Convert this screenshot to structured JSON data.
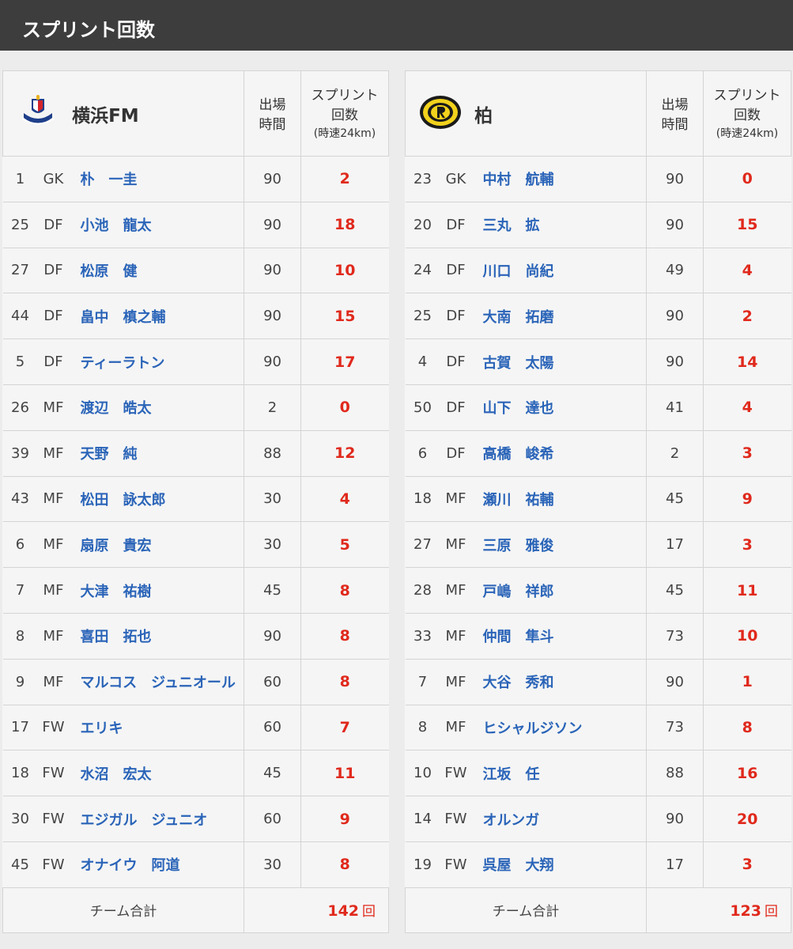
{
  "page_title": "スプリント回数",
  "columns": {
    "minutes": [
      "出場",
      "時間"
    ],
    "sprint": [
      "スプリント",
      "回数"
    ],
    "sprint_sub": "(時速24km)"
  },
  "total_label": "チーム合計",
  "total_unit": "回",
  "teams": [
    {
      "name": "横浜FM",
      "logo": "yokohama-fm-logo",
      "total": "142",
      "players": [
        {
          "no": "1",
          "pos": "GK",
          "name": "朴　一圭",
          "min": "90",
          "sprints": "2"
        },
        {
          "no": "25",
          "pos": "DF",
          "name": "小池　龍太",
          "min": "90",
          "sprints": "18"
        },
        {
          "no": "27",
          "pos": "DF",
          "name": "松原　健",
          "min": "90",
          "sprints": "10"
        },
        {
          "no": "44",
          "pos": "DF",
          "name": "畠中　槙之輔",
          "min": "90",
          "sprints": "15"
        },
        {
          "no": "5",
          "pos": "DF",
          "name": "ティーラトン",
          "min": "90",
          "sprints": "17"
        },
        {
          "no": "26",
          "pos": "MF",
          "name": "渡辺　皓太",
          "min": "2",
          "sprints": "0"
        },
        {
          "no": "39",
          "pos": "MF",
          "name": "天野　純",
          "min": "88",
          "sprints": "12"
        },
        {
          "no": "43",
          "pos": "MF",
          "name": "松田　詠太郎",
          "min": "30",
          "sprints": "4"
        },
        {
          "no": "6",
          "pos": "MF",
          "name": "扇原　貴宏",
          "min": "30",
          "sprints": "5"
        },
        {
          "no": "7",
          "pos": "MF",
          "name": "大津　祐樹",
          "min": "45",
          "sprints": "8"
        },
        {
          "no": "8",
          "pos": "MF",
          "name": "喜田　拓也",
          "min": "90",
          "sprints": "8"
        },
        {
          "no": "9",
          "pos": "MF",
          "name": "マルコス　ジュニオール",
          "min": "60",
          "sprints": "8"
        },
        {
          "no": "17",
          "pos": "FW",
          "name": "エリキ",
          "min": "60",
          "sprints": "7"
        },
        {
          "no": "18",
          "pos": "FW",
          "name": "水沼　宏太",
          "min": "45",
          "sprints": "11"
        },
        {
          "no": "30",
          "pos": "FW",
          "name": "エジガル　ジュニオ",
          "min": "60",
          "sprints": "9"
        },
        {
          "no": "45",
          "pos": "FW",
          "name": "オナイウ　阿道",
          "min": "30",
          "sprints": "8"
        }
      ]
    },
    {
      "name": "柏",
      "logo": "kashiwa-reysol-logo",
      "total": "123",
      "players": [
        {
          "no": "23",
          "pos": "GK",
          "name": "中村　航輔",
          "min": "90",
          "sprints": "0"
        },
        {
          "no": "20",
          "pos": "DF",
          "name": "三丸　拡",
          "min": "90",
          "sprints": "15"
        },
        {
          "no": "24",
          "pos": "DF",
          "name": "川口　尚紀",
          "min": "49",
          "sprints": "4"
        },
        {
          "no": "25",
          "pos": "DF",
          "name": "大南　拓磨",
          "min": "90",
          "sprints": "2"
        },
        {
          "no": "4",
          "pos": "DF",
          "name": "古賀　太陽",
          "min": "90",
          "sprints": "14"
        },
        {
          "no": "50",
          "pos": "DF",
          "name": "山下　達也",
          "min": "41",
          "sprints": "4"
        },
        {
          "no": "6",
          "pos": "DF",
          "name": "高橋　峻希",
          "min": "2",
          "sprints": "3"
        },
        {
          "no": "18",
          "pos": "MF",
          "name": "瀬川　祐輔",
          "min": "45",
          "sprints": "9"
        },
        {
          "no": "27",
          "pos": "MF",
          "name": "三原　雅俊",
          "min": "17",
          "sprints": "3"
        },
        {
          "no": "28",
          "pos": "MF",
          "name": "戸嶋　祥郎",
          "min": "45",
          "sprints": "11"
        },
        {
          "no": "33",
          "pos": "MF",
          "name": "仲間　隼斗",
          "min": "73",
          "sprints": "10"
        },
        {
          "no": "7",
          "pos": "MF",
          "name": "大谷　秀和",
          "min": "90",
          "sprints": "1"
        },
        {
          "no": "8",
          "pos": "MF",
          "name": "ヒシャルジソン",
          "min": "73",
          "sprints": "8"
        },
        {
          "no": "10",
          "pos": "FW",
          "name": "江坂　任",
          "min": "88",
          "sprints": "16"
        },
        {
          "no": "14",
          "pos": "FW",
          "name": "オルンガ",
          "min": "90",
          "sprints": "20"
        },
        {
          "no": "19",
          "pos": "FW",
          "name": "呉屋　大翔",
          "min": "17",
          "sprints": "3"
        }
      ]
    }
  ]
}
